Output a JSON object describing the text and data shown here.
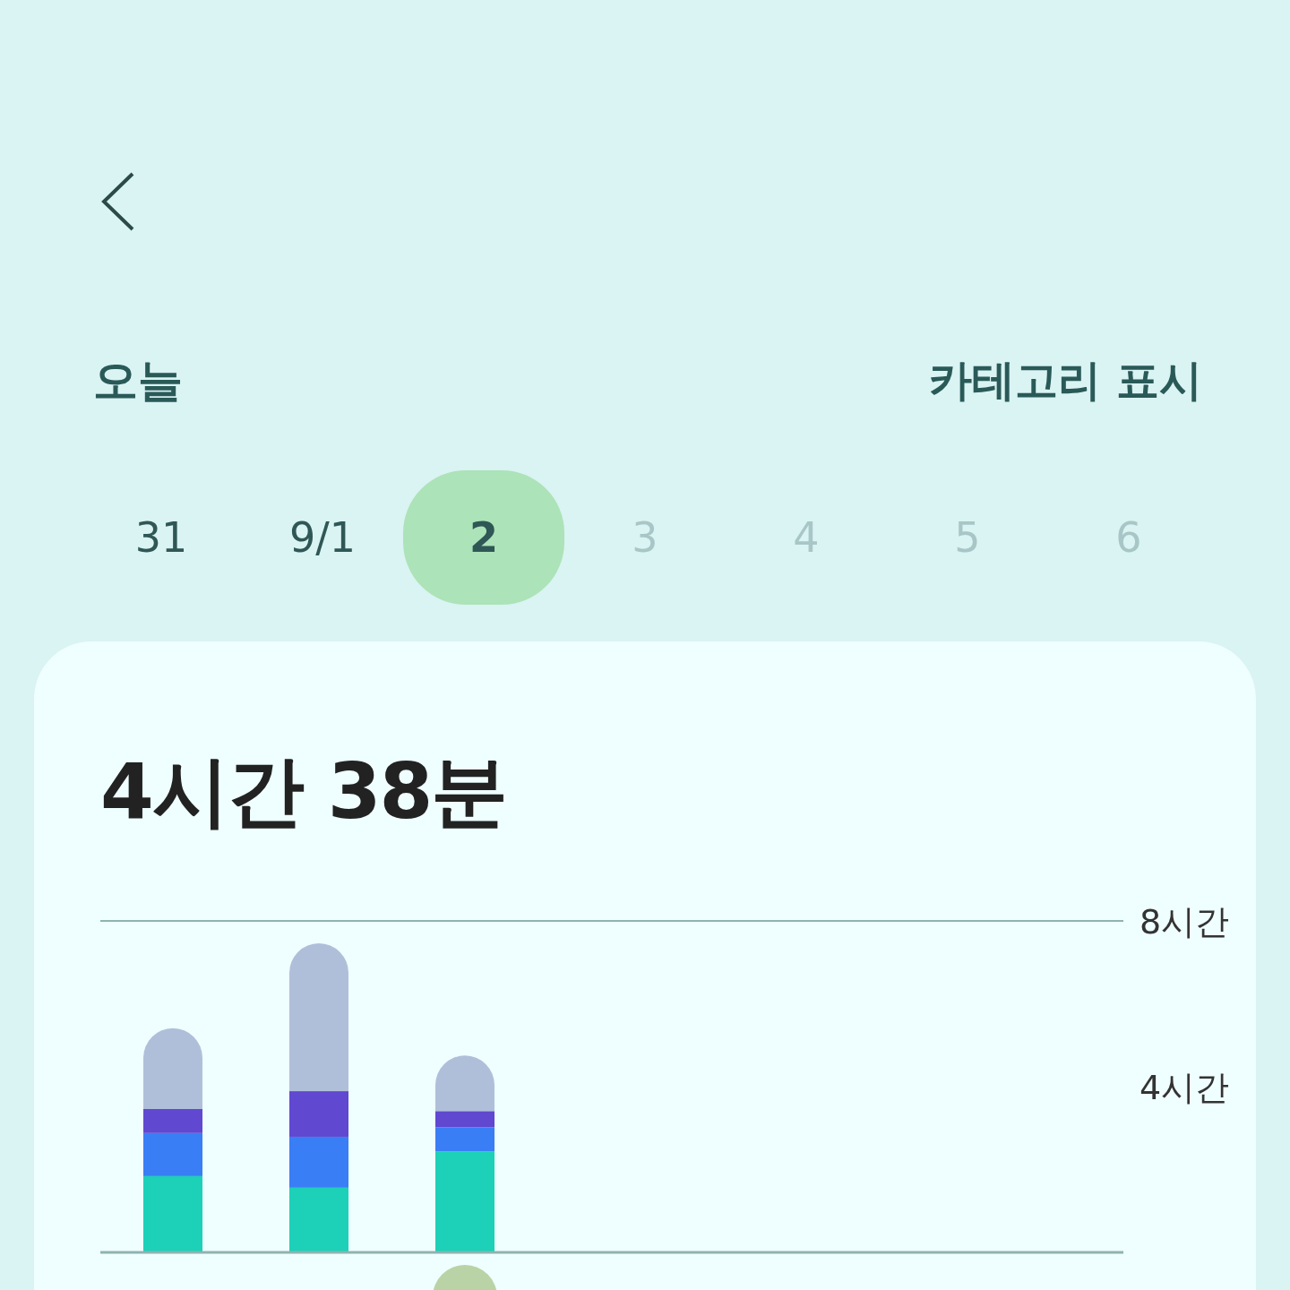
{
  "header": {
    "title": "오늘",
    "action": "카테고리 표시"
  },
  "days": [
    {
      "label": "31",
      "selected": false,
      "disabled": false
    },
    {
      "label": "9/1",
      "selected": false,
      "disabled": false
    },
    {
      "label": "2",
      "selected": true,
      "disabled": false
    },
    {
      "label": "3",
      "selected": false,
      "disabled": true
    },
    {
      "label": "4",
      "selected": false,
      "disabled": true
    },
    {
      "label": "5",
      "selected": false,
      "disabled": true
    },
    {
      "label": "6",
      "selected": false,
      "disabled": true
    }
  ],
  "summary": {
    "total": "4시간 38분"
  },
  "chart_data": {
    "type": "bar",
    "stacked": true,
    "ylim": [
      0,
      8
    ],
    "yticks": [
      {
        "value": 4,
        "label": "4시간"
      },
      {
        "value": 8,
        "label": "8시간"
      }
    ],
    "series": [
      {
        "color": "#1dd0b8",
        "values": [
          1.84,
          1.56,
          2.44,
          null,
          null,
          null,
          null
        ]
      },
      {
        "color": "#3a7ef5",
        "values": [
          1.04,
          1.23,
          0.58,
          null,
          null,
          null,
          null
        ]
      },
      {
        "color": "#6048d0",
        "values": [
          0.58,
          1.1,
          0.39,
          null,
          null,
          null,
          null
        ]
      },
      {
        "color": "#b0bfd9",
        "values": [
          1.95,
          3.57,
          1.34,
          null,
          null,
          null,
          null
        ]
      }
    ]
  }
}
